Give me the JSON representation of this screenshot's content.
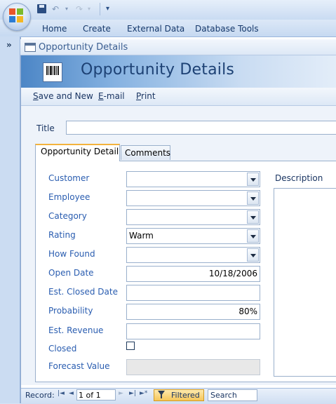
{
  "quick_access": {
    "undo_glyph": "↶",
    "redo_glyph": "↷",
    "dropdown_glyph": "▾",
    "customize_glyph": "▾"
  },
  "ribbon": {
    "tabs": [
      "Home",
      "Create",
      "External Data",
      "Database Tools"
    ]
  },
  "nav_pane": {
    "toggle_glyph": "»"
  },
  "document": {
    "tab_title": "Opportunity Details",
    "form_title": "Opportunity Details"
  },
  "commands": {
    "save_and_new": {
      "accel": "S",
      "rest": "ave and New"
    },
    "email": {
      "accel": "E",
      "rest": "-mail"
    },
    "print": {
      "accel": "P",
      "rest": "rint"
    }
  },
  "form": {
    "title_label": "Title",
    "title_value": "",
    "tabs": [
      "Opportunity Detail",
      "Comments"
    ],
    "active_tab": "Opportunity Detail",
    "fields": {
      "customer": {
        "label": "Customer",
        "value": ""
      },
      "employee": {
        "label": "Employee",
        "value": ""
      },
      "category": {
        "label": "Category",
        "value": ""
      },
      "rating": {
        "label": "Rating",
        "value": "Warm"
      },
      "how_found": {
        "label": "How Found",
        "value": ""
      },
      "open_date": {
        "label": "Open Date",
        "value": "10/18/2006"
      },
      "est_closed_date": {
        "label": "Est. Closed Date",
        "value": ""
      },
      "probability": {
        "label": "Probability",
        "value": "80%"
      },
      "est_revenue": {
        "label": "Est. Revenue",
        "value": ""
      },
      "closed": {
        "label": "Closed",
        "checked": false
      },
      "forecast_value": {
        "label": "Forecast Value",
        "value": ""
      }
    },
    "description_label": "Description"
  },
  "record_nav": {
    "label": "Record:",
    "first": "|◄",
    "prev": "◄",
    "current": "1 of 1",
    "next": "►",
    "last": "►|",
    "new": "►*",
    "filter_label": "Filtered",
    "search_label": "Search"
  },
  "colors": {
    "accent_header": "#4c86c6",
    "label_blue": "#2a5db0",
    "tab_highlight": "#f3b33d",
    "filter_fill": "#f6c659"
  }
}
